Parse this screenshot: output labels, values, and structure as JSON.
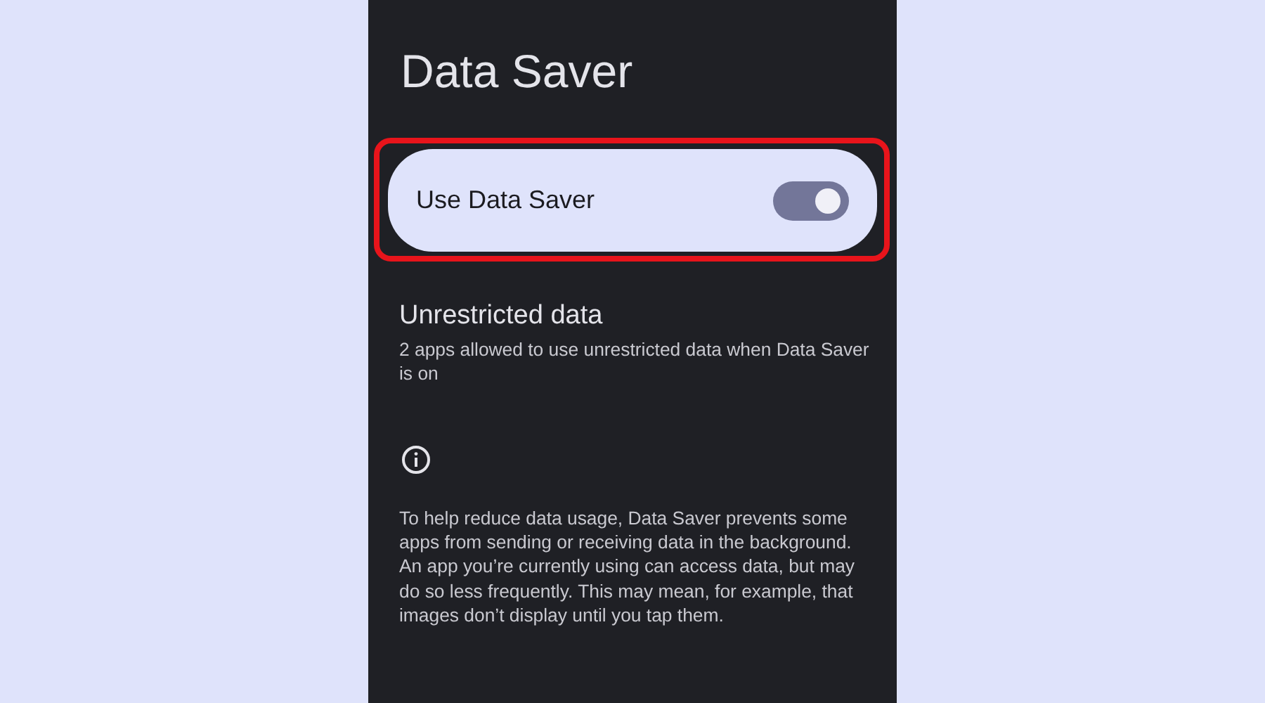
{
  "screen": {
    "title": "Data Saver"
  },
  "toggle_row": {
    "label": "Use Data Saver",
    "on": true,
    "highlighted": true
  },
  "unrestricted_data": {
    "title": "Unrestricted data",
    "summary": "2 apps allowed to use unrestricted data when Data Saver is on"
  },
  "info": {
    "text": "To help reduce data usage, Data Saver prevents some apps from sending or receiving data in the background. An app you’re currently using can access data, but may do so less frequently. This may mean, for example, that images don’t display until you tap them."
  }
}
